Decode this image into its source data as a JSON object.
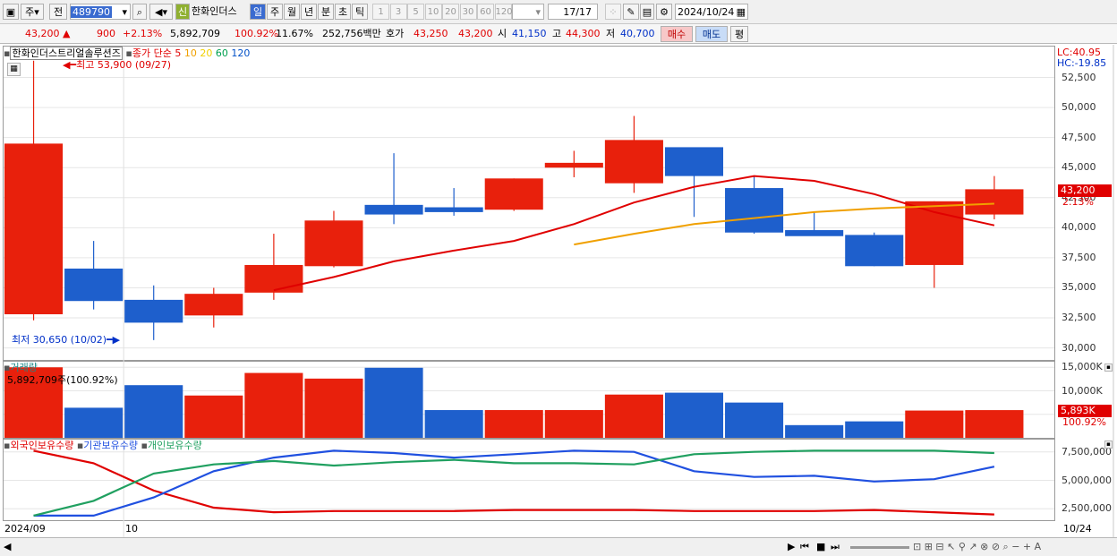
{
  "toolbar": {
    "market": "주",
    "prev": "전",
    "code": "489790",
    "new_badge": "신",
    "stock_name": "한화인더스",
    "period_tabs": [
      "일",
      "주",
      "월",
      "년",
      "분",
      "초",
      "틱"
    ],
    "active_period": "일",
    "intervals": [
      "1",
      "3",
      "5",
      "10",
      "20",
      "30",
      "60",
      "120"
    ],
    "count": "17",
    "total": "/17",
    "date": "2024/10/24"
  },
  "info": {
    "price": "43,200",
    "change": "900",
    "change_pct": "+2.13%",
    "volume": "5,892,709",
    "vol_ratio": "100.92%",
    "turnover": "11.67%",
    "amount": "252,756백만",
    "bid_label": "호가",
    "ask": "43,250",
    "bid": "43,200",
    "open_label": "시",
    "open": "41,150",
    "high_label": "고",
    "high": "44,300",
    "low_label": "저",
    "low": "40,700",
    "buy_button": "매수",
    "sell_button": "매도",
    "eval_button": "평"
  },
  "chart_data": {
    "type": "candlestick",
    "title": "한화인더스트리얼솔루션즈",
    "ma_label": "종가 단순",
    "ma_periods": [
      "5",
      "10",
      "20",
      "60",
      "120"
    ],
    "ma_colors": [
      "#e00000",
      "#f0a000",
      "#f0d000",
      "#00a050",
      "#0050c8"
    ],
    "ohlc": [
      {
        "o": 32800,
        "h": 53900,
        "l": 32300,
        "c": 47000
      },
      {
        "o": 36600,
        "h": 38900,
        "l": 33200,
        "c": 33900
      },
      {
        "o": 34000,
        "h": 35200,
        "l": 30650,
        "c": 32100
      },
      {
        "o": 32700,
        "h": 35000,
        "l": 31700,
        "c": 34500
      },
      {
        "o": 34600,
        "h": 39500,
        "l": 34000,
        "c": 36900
      },
      {
        "o": 36800,
        "h": 41400,
        "l": 36700,
        "c": 40600
      },
      {
        "o": 41900,
        "h": 46200,
        "l": 40300,
        "c": 41100
      },
      {
        "o": 41700,
        "h": 43300,
        "l": 41000,
        "c": 41300
      },
      {
        "o": 41500,
        "h": 44100,
        "l": 41400,
        "c": 44100
      },
      {
        "o": 45000,
        "h": 46400,
        "l": 44200,
        "c": 45400
      },
      {
        "o": 43700,
        "h": 49300,
        "l": 42900,
        "c": 47300
      },
      {
        "o": 46700,
        "h": 45800,
        "l": 40900,
        "c": 44300
      },
      {
        "o": 43300,
        "h": 44300,
        "l": 39500,
        "c": 39600
      },
      {
        "o": 39800,
        "h": 41300,
        "l": 39400,
        "c": 39300
      },
      {
        "o": 39400,
        "h": 39600,
        "l": 36800,
        "c": 36800
      },
      {
        "o": 36900,
        "h": 42200,
        "l": 35000,
        "c": 42200
      },
      {
        "o": 41100,
        "h": 44300,
        "l": 40700,
        "c": 43200
      }
    ],
    "ma5": [
      null,
      null,
      null,
      null,
      34800,
      35900,
      37200,
      38100,
      38900,
      40300,
      42100,
      43400,
      44300,
      43900,
      42800,
      41300,
      40200
    ],
    "ma10": [
      null,
      null,
      null,
      null,
      null,
      null,
      null,
      null,
      null,
      38600,
      39500,
      40300,
      40800,
      41300,
      41600,
      41800,
      42000
    ],
    "price_axis": [
      "52,500",
      "50,000",
      "47,500",
      "45,000",
      "42,500",
      "40,000",
      "37,500",
      "35,000",
      "32,500",
      "30,000"
    ],
    "price_range": [
      29000,
      55000
    ],
    "high_note": "최고 53,900 (09/27)",
    "low_note": "최저 30,650 (10/02)",
    "lc": "LC:40.95",
    "hc": "HC:-19.85",
    "last_price_label": "43,200",
    "last_change_label": "2.13%",
    "volume_label": "거래량",
    "volume_note": "5,892,709주(100.92%)",
    "volume_values": [
      15000000,
      6400000,
      11200000,
      9000000,
      13800000,
      12600000,
      14900000,
      5900000,
      5900000,
      5900000,
      9200000,
      9600000,
      7500000,
      2700000,
      3500000,
      5800000,
      5893000
    ],
    "volume_axis": [
      "15,000K",
      "10,000K",
      "5,000K"
    ],
    "volume_range": [
      0,
      16000000
    ],
    "volume_last_label": "5,893K",
    "volume_last_pct": "100.92%",
    "holdings_legend": [
      "외국인보유수량",
      "기관보유수량",
      "개인보유수량"
    ],
    "holdings_colors": [
      "#e00000",
      "#2050e0",
      "#20a060"
    ],
    "holdings_axis": [
      "7,500,000",
      "5,000,000",
      "2,500,000"
    ],
    "holdings_range": [
      1500000,
      8500000
    ],
    "foreign": [
      7600000,
      6500000,
      4100000,
      2600000,
      2200000,
      2300000,
      2300000,
      2300000,
      2400000,
      2400000,
      2400000,
      2300000,
      2300000,
      2300000,
      2400000,
      2200000,
      2000000
    ],
    "institution": [
      1900000,
      1900000,
      3500000,
      5800000,
      7000000,
      7600000,
      7400000,
      7000000,
      7300000,
      7600000,
      7500000,
      5800000,
      5300000,
      5400000,
      4900000,
      5100000,
      6200000
    ],
    "individual": [
      1900000,
      3200000,
      5600000,
      6400000,
      6700000,
      6300000,
      6600000,
      6800000,
      6500000,
      6500000,
      6400000,
      7300000,
      7500000,
      7600000,
      7600000,
      7600000,
      7400000
    ],
    "x_labels": [
      "2024/09",
      "10",
      "10/24"
    ]
  }
}
